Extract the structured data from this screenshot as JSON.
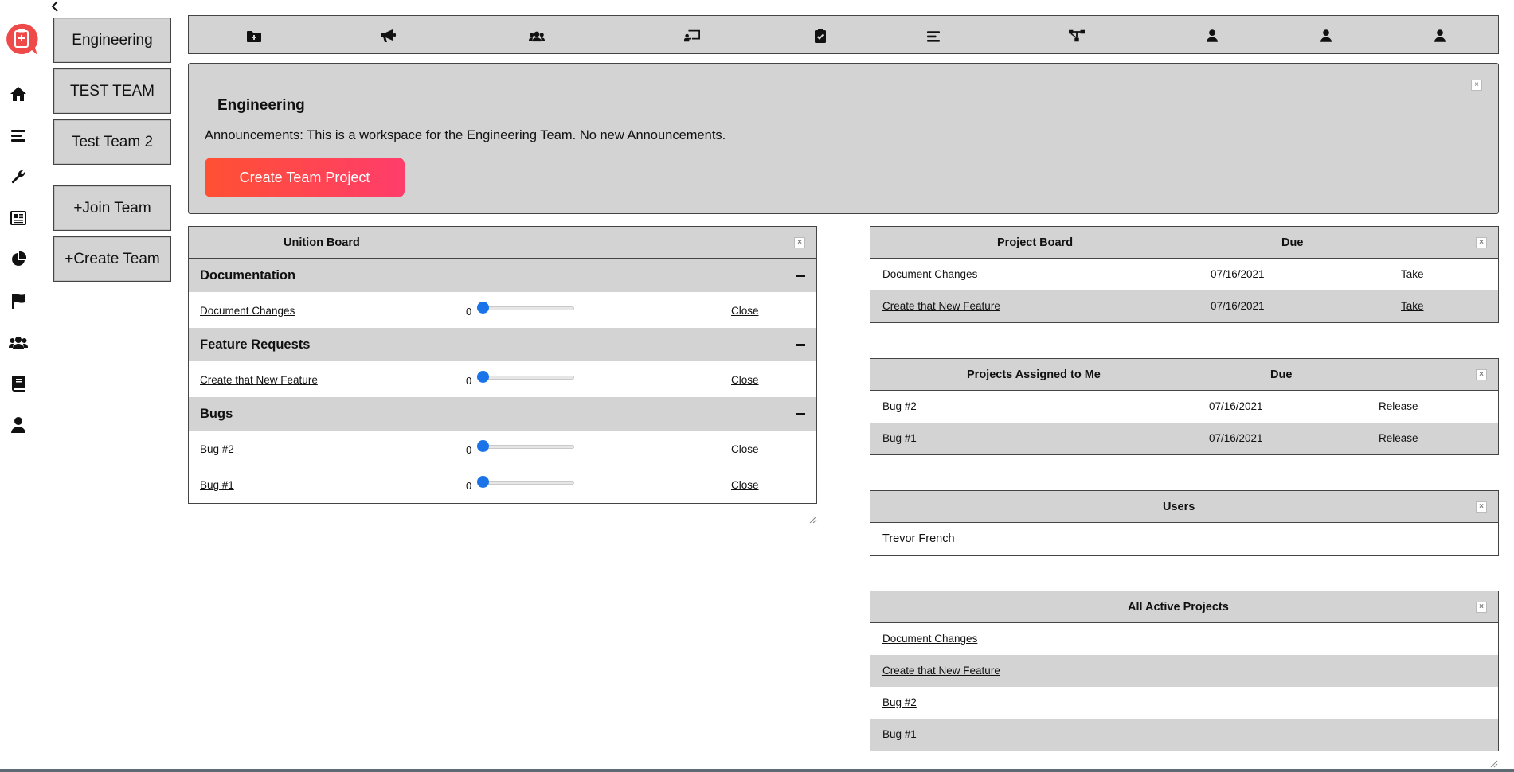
{
  "sidebar": {
    "collapse_icon": "chevron-left-icon",
    "logo_icon": "clipboard-medical-icon",
    "brand_color": "#ef4a4a",
    "items": [
      {
        "icon": "home-icon"
      },
      {
        "icon": "list-icon"
      },
      {
        "icon": "wrench-icon"
      },
      {
        "icon": "newspaper-icon"
      },
      {
        "icon": "pie-chart-icon"
      },
      {
        "icon": "flag-icon"
      },
      {
        "icon": "users-icon"
      },
      {
        "icon": "book-icon"
      },
      {
        "icon": "user-icon"
      }
    ]
  },
  "teams": {
    "items": [
      "Engineering",
      "TEST TEAM",
      "Test Team 2"
    ],
    "join_label": "+Join Team",
    "create_label": "+Create Team"
  },
  "toolbar": {
    "icons": [
      "folder-plus-icon",
      "megaphone-icon",
      "users-icon",
      "chalkboard-teacher-icon",
      "clipboard-check-icon",
      "list-icon",
      "sitemap-icon",
      "user-icon",
      "user-icon",
      "user-icon"
    ]
  },
  "announcement": {
    "title": "Engineering",
    "text": "Announcements: This is a workspace for the Engineering Team. No new Announcements.",
    "create_project_label": "Create Team Project",
    "button_gradient": [
      "#ff5033",
      "#ff3d6b"
    ]
  },
  "unition_board": {
    "title": "Unition Board",
    "groups": [
      {
        "name": "Documentation",
        "items": [
          {
            "name": "Document Changes",
            "value": "0",
            "action": "Close"
          }
        ]
      },
      {
        "name": "Feature Requests",
        "items": [
          {
            "name": "Create that New Feature",
            "value": "0",
            "action": "Close"
          }
        ]
      },
      {
        "name": "Bugs",
        "items": [
          {
            "name": "Bug #2",
            "value": "0",
            "action": "Close"
          },
          {
            "name": "Bug #1",
            "value": "0",
            "action": "Close"
          }
        ]
      }
    ]
  },
  "project_board": {
    "title": "Project Board",
    "due_header": "Due",
    "rows": [
      {
        "name": "Document Changes",
        "due": "07/16/2021",
        "action": "Take"
      },
      {
        "name": "Create that New Feature",
        "due": "07/16/2021",
        "action": "Take"
      }
    ]
  },
  "assigned": {
    "title": "Projects Assigned to Me",
    "due_header": "Due",
    "rows": [
      {
        "name": "Bug #2",
        "due": "07/16/2021",
        "action": "Release"
      },
      {
        "name": "Bug #1",
        "due": "07/16/2021",
        "action": "Release"
      }
    ]
  },
  "users": {
    "title": "Users",
    "items": [
      "Trevor French"
    ]
  },
  "active_projects": {
    "title": "All Active Projects",
    "items": [
      "Document Changes",
      "Create that New Feature",
      "Bug #2",
      "Bug #1"
    ]
  },
  "close_glyph": "×",
  "slider_color": "#1a73e8"
}
